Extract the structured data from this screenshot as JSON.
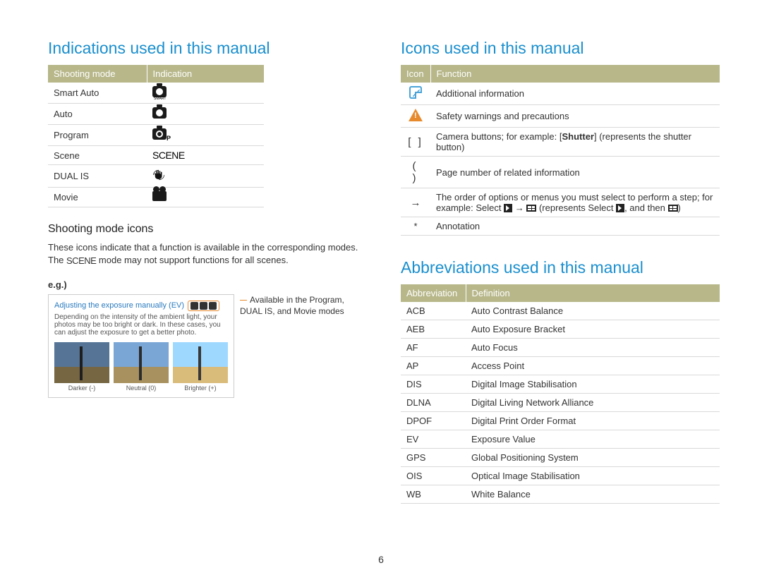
{
  "page_number": "6",
  "left": {
    "heading": "Indications used in this manual",
    "table": {
      "headers": [
        "Shooting mode",
        "Indication"
      ],
      "rows": [
        {
          "mode": "Smart Auto",
          "icon": "camera-smart-icon"
        },
        {
          "mode": "Auto",
          "icon": "camera-icon"
        },
        {
          "mode": "Program",
          "icon": "camera-p-icon"
        },
        {
          "mode": "Scene",
          "icon": "scene-icon"
        },
        {
          "mode": "DUAL IS",
          "icon": "hand-icon"
        },
        {
          "mode": "Movie",
          "icon": "movie-icon"
        }
      ]
    },
    "subheading": "Shooting mode icons",
    "para_before_scene": "These icons indicate that a function is available in the corresponding modes. The ",
    "para_after_scene": " mode may not support functions for all scenes.",
    "scene_inline": "SCENE",
    "eg_label": "e.g.)",
    "example": {
      "title": "Adjusting the exposure manually (EV)",
      "desc": "Depending on the intensity of the ambient light, your photos may be too bright or dark. In these cases, you can adjust the exposure to get a better photo.",
      "thumbs": [
        "Darker (-)",
        "Neutral (0)",
        "Brighter (+)"
      ],
      "caption": "Available in the Program, DUAL IS, and Movie modes"
    }
  },
  "right_icons": {
    "heading": "Icons used in this manual",
    "headers": [
      "Icon",
      "Function"
    ],
    "rows": [
      {
        "icon": "note-icon",
        "text": "Additional information"
      },
      {
        "icon": "warn-icon",
        "text": "Safety warnings and precautions"
      },
      {
        "icon": "brackets-icon",
        "text_html": "Camera buttons; for example: [<b>Shutter</b>] (represents the shutter button)"
      },
      {
        "icon": "parens-icon",
        "text": "Page number of related information"
      },
      {
        "icon": "arrow-icon",
        "text_html": "The order of options or menus you must select to perform a step; for example: Select <span class='ic-chev'></span> → <span class='ic-grid'></span> (represents Select <span class='ic-chev'></span>, and then <span class='ic-grid'></span>)"
      },
      {
        "icon": "asterisk-icon",
        "text": "Annotation"
      }
    ]
  },
  "right_abbrev": {
    "heading": "Abbreviations used in this manual",
    "headers": [
      "Abbreviation",
      "Definition"
    ],
    "rows": [
      {
        "abbr": "ACB",
        "def": "Auto Contrast Balance"
      },
      {
        "abbr": "AEB",
        "def": "Auto Exposure Bracket"
      },
      {
        "abbr": "AF",
        "def": "Auto Focus"
      },
      {
        "abbr": "AP",
        "def": "Access Point"
      },
      {
        "abbr": "DIS",
        "def": "Digital Image Stabilisation"
      },
      {
        "abbr": "DLNA",
        "def": "Digital Living Network Alliance"
      },
      {
        "abbr": "DPOF",
        "def": "Digital Print Order Format"
      },
      {
        "abbr": "EV",
        "def": "Exposure Value"
      },
      {
        "abbr": "GPS",
        "def": "Global Positioning System"
      },
      {
        "abbr": "OIS",
        "def": "Optical Image Stabilisation"
      },
      {
        "abbr": "WB",
        "def": "White Balance"
      }
    ]
  }
}
